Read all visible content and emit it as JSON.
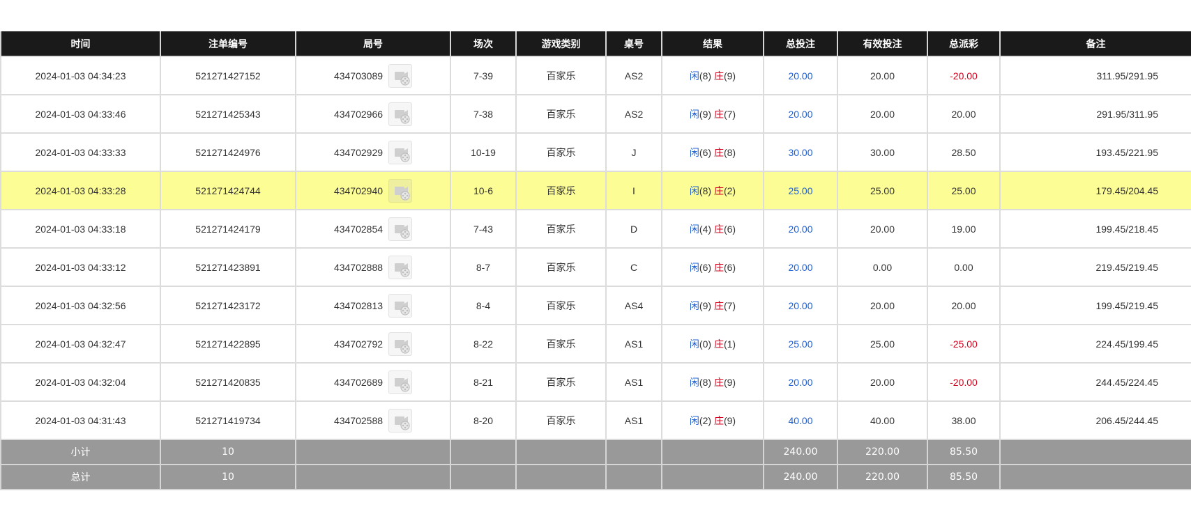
{
  "table": {
    "columns": [
      "时间",
      "注单编号",
      "局号",
      "场次",
      "游戏类别",
      "桌号",
      "结果",
      "总投注",
      "有效投注",
      "总派彩",
      "备注"
    ],
    "rows": [
      {
        "time": "2024-01-03 04:34:23",
        "bet_id": "521271427152",
        "round_no": "434703089",
        "session": "7-39",
        "game": "百家乐",
        "table": "AS2",
        "player_label": "闲",
        "player_score": "(8)",
        "banker_label": "庄",
        "banker_score": "(9)",
        "total_bet": "20.00",
        "valid_bet": "20.00",
        "payout": "-20.00",
        "payout_negative": true,
        "memo": "311.95/291.95",
        "highlighted": false
      },
      {
        "time": "2024-01-03 04:33:46",
        "bet_id": "521271425343",
        "round_no": "434702966",
        "session": "7-38",
        "game": "百家乐",
        "table": "AS2",
        "player_label": "闲",
        "player_score": "(9)",
        "banker_label": "庄",
        "banker_score": "(7)",
        "total_bet": "20.00",
        "valid_bet": "20.00",
        "payout": "20.00",
        "payout_negative": false,
        "memo": "291.95/311.95",
        "highlighted": false
      },
      {
        "time": "2024-01-03 04:33:33",
        "bet_id": "521271424976",
        "round_no": "434702929",
        "session": "10-19",
        "game": "百家乐",
        "table": "J",
        "player_label": "闲",
        "player_score": "(6)",
        "banker_label": "庄",
        "banker_score": "(8)",
        "total_bet": "30.00",
        "valid_bet": "30.00",
        "payout": "28.50",
        "payout_negative": false,
        "memo": "193.45/221.95",
        "highlighted": false
      },
      {
        "time": "2024-01-03 04:33:28",
        "bet_id": "521271424744",
        "round_no": "434702940",
        "session": "10-6",
        "game": "百家乐",
        "table": "I",
        "player_label": "闲",
        "player_score": "(8)",
        "banker_label": "庄",
        "banker_score": "(2)",
        "total_bet": "25.00",
        "valid_bet": "25.00",
        "payout": "25.00",
        "payout_negative": false,
        "memo": "179.45/204.45",
        "highlighted": true
      },
      {
        "time": "2024-01-03 04:33:18",
        "bet_id": "521271424179",
        "round_no": "434702854",
        "session": "7-43",
        "game": "百家乐",
        "table": "D",
        "player_label": "闲",
        "player_score": "(4)",
        "banker_label": "庄",
        "banker_score": "(6)",
        "total_bet": "20.00",
        "valid_bet": "20.00",
        "payout": "19.00",
        "payout_negative": false,
        "memo": "199.45/218.45",
        "highlighted": false
      },
      {
        "time": "2024-01-03 04:33:12",
        "bet_id": "521271423891",
        "round_no": "434702888",
        "session": "8-7",
        "game": "百家乐",
        "table": "C",
        "player_label": "闲",
        "player_score": "(6)",
        "banker_label": "庄",
        "banker_score": "(6)",
        "total_bet": "20.00",
        "valid_bet": "0.00",
        "payout": "0.00",
        "payout_negative": false,
        "memo": "219.45/219.45",
        "highlighted": false
      },
      {
        "time": "2024-01-03 04:32:56",
        "bet_id": "521271423172",
        "round_no": "434702813",
        "session": "8-4",
        "game": "百家乐",
        "table": "AS4",
        "player_label": "闲",
        "player_score": "(9)",
        "banker_label": "庄",
        "banker_score": "(7)",
        "total_bet": "20.00",
        "valid_bet": "20.00",
        "payout": "20.00",
        "payout_negative": false,
        "memo": "199.45/219.45",
        "highlighted": false
      },
      {
        "time": "2024-01-03 04:32:47",
        "bet_id": "521271422895",
        "round_no": "434702792",
        "session": "8-22",
        "game": "百家乐",
        "table": "AS1",
        "player_label": "闲",
        "player_score": "(0)",
        "banker_label": "庄",
        "banker_score": "(1)",
        "total_bet": "25.00",
        "valid_bet": "25.00",
        "payout": "-25.00",
        "payout_negative": true,
        "memo": "224.45/199.45",
        "highlighted": false
      },
      {
        "time": "2024-01-03 04:32:04",
        "bet_id": "521271420835",
        "round_no": "434702689",
        "session": "8-21",
        "game": "百家乐",
        "table": "AS1",
        "player_label": "闲",
        "player_score": "(8)",
        "banker_label": "庄",
        "banker_score": "(9)",
        "total_bet": "20.00",
        "valid_bet": "20.00",
        "payout": "-20.00",
        "payout_negative": true,
        "memo": "244.45/224.45",
        "highlighted": false
      },
      {
        "time": "2024-01-03 04:31:43",
        "bet_id": "521271419734",
        "round_no": "434702588",
        "session": "8-20",
        "game": "百家乐",
        "table": "AS1",
        "player_label": "闲",
        "player_score": "(2)",
        "banker_label": "庄",
        "banker_score": "(9)",
        "total_bet": "40.00",
        "valid_bet": "40.00",
        "payout": "38.00",
        "payout_negative": false,
        "memo": "206.45/244.45",
        "highlighted": false
      }
    ],
    "summary": [
      {
        "label": "小计",
        "count": "10",
        "total_bet": "240.00",
        "valid_bet": "220.00",
        "payout": "85.50"
      },
      {
        "label": "总计",
        "count": "10",
        "total_bet": "240.00",
        "valid_bet": "220.00",
        "payout": "85.50"
      }
    ]
  },
  "icons": {
    "replay": "video-replay-icon"
  },
  "colors": {
    "header_bg": "#1a1a1a",
    "highlight_row": "#fdfd96",
    "summary_bg": "#999999",
    "player_blue": "#1f5fd1",
    "banker_red": "#d0021b",
    "negative_red": "#d0021b"
  }
}
